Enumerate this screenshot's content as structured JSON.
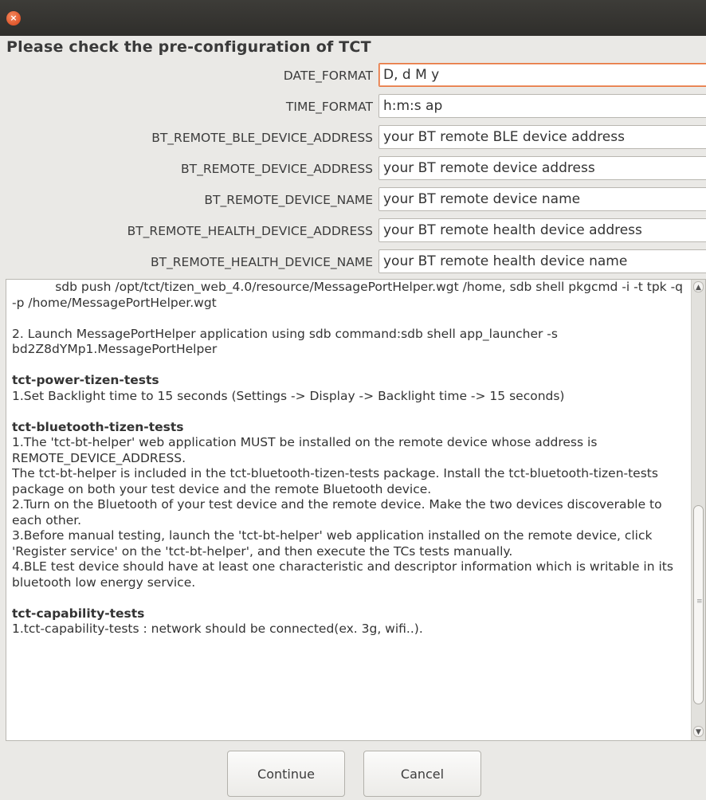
{
  "window": {
    "close_glyph": "×"
  },
  "heading": "Please check the pre-configuration of TCT",
  "fields": [
    {
      "label": "DATE_FORMAT",
      "value": "D, d M y"
    },
    {
      "label": "TIME_FORMAT",
      "value": "h:m:s ap"
    },
    {
      "label": "BT_REMOTE_BLE_DEVICE_ADDRESS",
      "value": "your BT remote BLE device address"
    },
    {
      "label": "BT_REMOTE_DEVICE_ADDRESS",
      "value": "your BT remote device address"
    },
    {
      "label": "BT_REMOTE_DEVICE_NAME",
      "value": "your BT remote device name"
    },
    {
      "label": "BT_REMOTE_HEALTH_DEVICE_ADDRESS",
      "value": "your BT remote health device address"
    },
    {
      "label": "BT_REMOTE_HEALTH_DEVICE_NAME",
      "value": "your BT remote health device name"
    }
  ],
  "notes": {
    "l1": "           sdb push /opt/tct/tizen_web_4.0/resource/MessagePortHelper.wgt /home, sdb shell pkgcmd -i -t tpk -q -p /home/MessagePortHelper.wgt",
    "l2": "2. Launch MessagePortHelper application using sdb command:sdb shell app_launcher -s bd2Z8dYMp1.MessagePortHelper",
    "power_title": "tct-power-tizen-tests",
    "power_1": "1.Set Backlight time to 15 seconds (Settings -> Display -> Backlight time -> 15 seconds)",
    "bt_title": "tct-bluetooth-tizen-tests",
    "bt_1": "1.The 'tct-bt-helper' web application MUST be installed on the remote device whose address is REMOTE_DEVICE_ADDRESS.",
    "bt_1b": "The tct-bt-helper is included in the tct-bluetooth-tizen-tests package. Install the tct-bluetooth-tizen-tests package on both your test device and the remote Bluetooth device.",
    "bt_2": "2.Turn on the Bluetooth of your test device and the remote device. Make the two devices discoverable to each other.",
    "bt_3": "3.Before manual testing, launch the 'tct-bt-helper' web application installed on the remote device, click 'Register service' on the 'tct-bt-helper', and then execute the TCs tests manually.",
    "bt_4": "4.BLE test device should have at least one characteristic and descriptor information which is writable in its bluetooth low energy service.",
    "cap_title": "tct-capability-tests",
    "cap_1": "1.tct-capability-tests : network should be connected(ex. 3g, wifi..)."
  },
  "buttons": {
    "continue": "Continue",
    "cancel": "Cancel"
  },
  "icons": {
    "close": "close-icon",
    "scroll_up": "scroll-up-icon",
    "scroll_down": "scroll-down-icon"
  },
  "colors": {
    "titlebar": "#3d3c38",
    "close_button": "#e0572c",
    "focus_border": "#e6743c"
  }
}
